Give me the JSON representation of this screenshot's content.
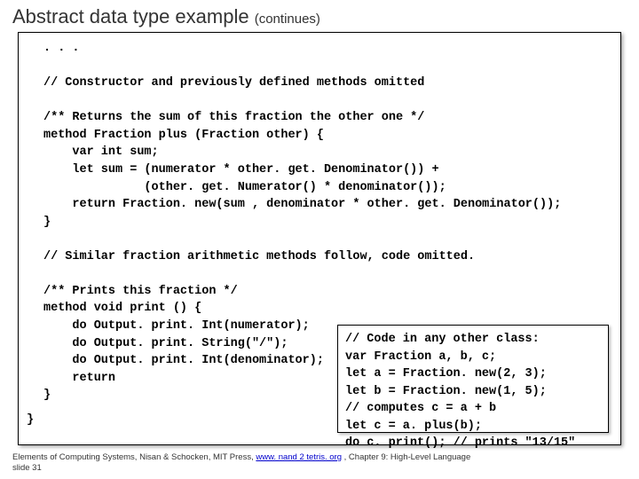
{
  "title": "Abstract data type example",
  "title_cont": "(continues)",
  "code_html": "<b>. . .</b>\n\n<b>// Constructor and previously defined methods omitted</b>\n\n<b>/** Returns the sum of this fraction the other one */</b>\n<b>method Fraction plus (Fraction other) {</b>\n    <b>var int sum;</b>\n    <b>let sum = (numerator * other. get. Denominator()) +</b>\n              <b>(other. get. Numerator() * denominator());</b>\n    <b>return Fraction. new(sum , denominator * other. get. Denominator());</b>\n<b>}</b>\n\n<b>// Similar fraction arithmetic methods follow, code omitted.</b>\n\n<b>/** Prints this fraction */</b>\n<b>method void print () {</b>\n    <b>do Output. print. Int(numerator);</b>\n    <b>do Output. print. String(\"/\");</b>\n    <b>do Output. print. Int(denominator);</b>\n    <b>return</b>\n<b>}</b>",
  "closing_brace": "}",
  "inner_code_html": "<b>// Code in any other class:</b>\n<b>var Fraction a, b, c;</b>\n<b>let a = Fraction. new(2, 3);</b>\n<b>let b = Fraction. new(1, 5);</b>\n<b>// computes c = a + b</b>\n<b>let c = a. plus(b);</b>\n<b>do c. print(); // prints \"13/15\"</b>",
  "footer_pre": "Elements of Computing Systems, Nisan & Schocken, MIT Press, ",
  "footer_link": "www. nand 2 tetris. org",
  "footer_post": " , Chapter 9: High-Level Language",
  "footer_slide": "slide 31"
}
